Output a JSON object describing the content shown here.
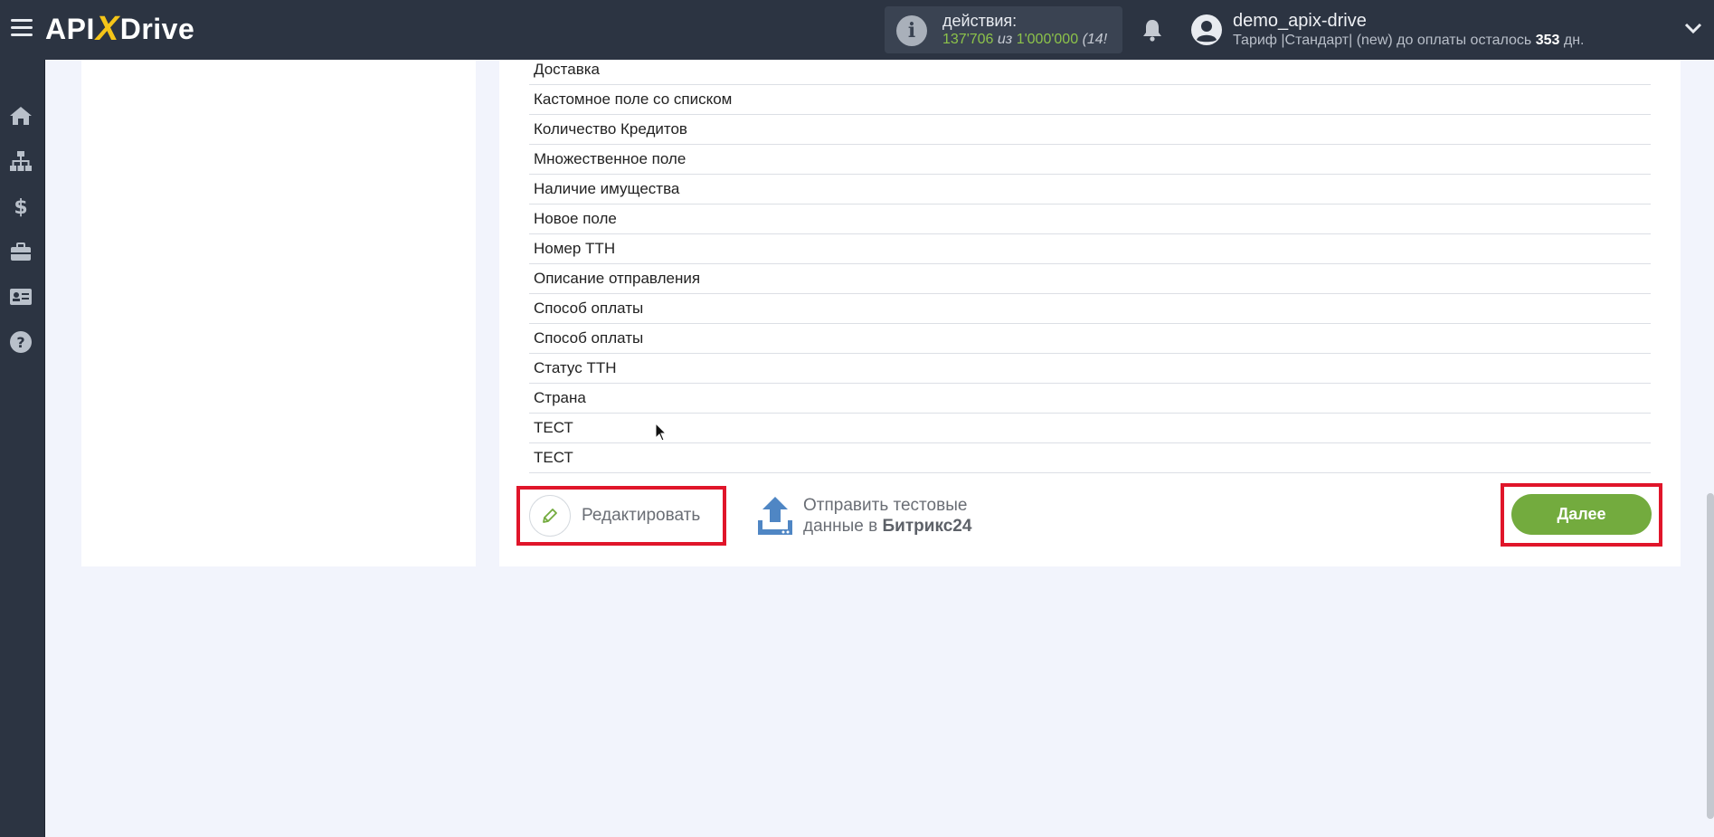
{
  "app": {
    "logo_left": "API",
    "logo_x": "X",
    "logo_right": "Drive"
  },
  "header": {
    "actions_label": "действия:",
    "actions_used": "137'706",
    "actions_of": "из",
    "actions_total": "1'000'000",
    "actions_extra": "(14!",
    "user_name": "demo_apix-drive",
    "plan_text": "Тариф |Стандарт| (new) до оплаты осталось",
    "plan_days": "353",
    "plan_days_unit": "дн."
  },
  "sidebar": {
    "items": [
      {
        "name": "home-icon"
      },
      {
        "name": "sitemap-icon"
      },
      {
        "name": "dollar-icon"
      },
      {
        "name": "briefcase-icon"
      },
      {
        "name": "id-card-icon"
      },
      {
        "name": "help-icon"
      }
    ]
  },
  "fields": [
    "Доставка",
    "Кастомное поле со списком",
    "Количество Кредитов",
    "Множественное поле",
    "Наличие имущества",
    "Новое поле",
    "Номер ТТН",
    "Описание отправления",
    "Способ оплаты",
    "Способ оплаты",
    "Статус ТТН",
    "Страна",
    "ТЕСТ",
    "ТЕСТ"
  ],
  "buttons": {
    "edit_label": "Редактировать",
    "send_line1": "Отправить тестовые",
    "send_line2_prefix": "данные в",
    "send_line2_bold": "Битрикс24",
    "next_label": "Далее"
  },
  "colors": {
    "header_bg": "#2c3442",
    "accent_green": "#73ab3e",
    "highlight_red": "#e0152a",
    "logo_x_yellow": "#f5c518"
  }
}
